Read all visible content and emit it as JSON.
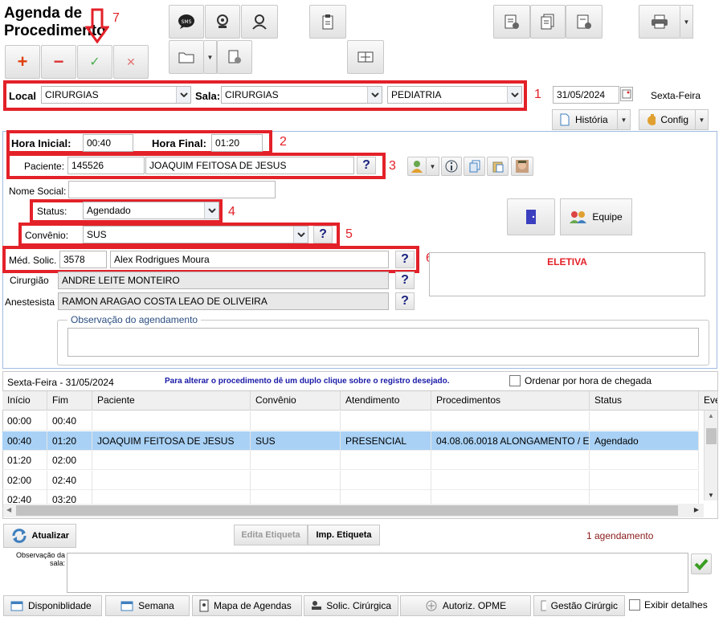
{
  "header": {
    "title_line1": "Agenda de",
    "title_line2": "Procedimento"
  },
  "toolbar": {
    "add": "+",
    "remove": "−",
    "confirm": "✓",
    "cancel": "✕"
  },
  "location": {
    "local_label": "Local",
    "local_value": "CIRURGIAS",
    "sala_label": "Sala:",
    "sala_value": "CIRURGIAS",
    "specialty_value": "PEDIATRIA",
    "date": "31/05/2024",
    "weekday": "Sexta-Feira"
  },
  "actions": {
    "historia": "História",
    "config": "Config"
  },
  "time": {
    "start_label": "Hora Inicial:",
    "start_value": "00:40",
    "end_label": "Hora Final:",
    "end_value": "01:20"
  },
  "patient": {
    "label": "Paciente:",
    "id": "145526",
    "name": "JOAQUIM  FEITOSA DE JESUS",
    "social_label": "Nome Social:",
    "social_value": ""
  },
  "status": {
    "label": "Status:",
    "value": "Agendado"
  },
  "convenio": {
    "label": "Convênio:",
    "value": "SUS"
  },
  "medico": {
    "label": "Méd. Solic.",
    "id": "3578",
    "name": "Alex Rodrigues Moura"
  },
  "cirurgiao": {
    "label": "Cirurgião",
    "value": "ANDRE LEITE MONTEIRO"
  },
  "anestesista": {
    "label": "Anestesista",
    "value": "RAMON ARAGAO COSTA LEAO DE OLIVEIRA"
  },
  "eletiva": "ELETIVA",
  "equipe": "Equipe",
  "observacao": {
    "legend": "Observação do agendamento",
    "value": ""
  },
  "annotations": {
    "n1": "1",
    "n2": "2",
    "n3": "3",
    "n4": "4",
    "n5": "5",
    "n6": "6",
    "n7": "7"
  },
  "schedule": {
    "day": "Sexta-Feira - 31/05/2024",
    "hint": "Para alterar o procedimento dê um duplo clique sobre o registro desejado.",
    "order_label": "Ordenar por hora de chegada",
    "columns": [
      "Início",
      "Fim",
      "Paciente",
      "Convênio",
      "Atendimento",
      "Procedimentos",
      "Status",
      "Eve"
    ],
    "rows": [
      [
        "00:00",
        "00:40",
        "",
        "",
        "",
        "",
        ""
      ],
      [
        "00:40",
        "01:20",
        "JOAQUIM FEITOSA DE JESUS",
        "SUS",
        "PRESENCIAL",
        "04.08.06.0018 ALONGAMENTO / E",
        "Agendado"
      ],
      [
        "01:20",
        "02:00",
        "",
        "",
        "",
        "",
        ""
      ],
      [
        "02:00",
        "02:40",
        "",
        "",
        "",
        "",
        ""
      ],
      [
        "02:40",
        "03:20",
        "",
        "",
        "",
        "",
        ""
      ]
    ]
  },
  "footer": {
    "atualizar": "Atualizar",
    "edita_etiqueta": "Edita Etiqueta",
    "imp_etiqueta": "Imp. Etiqueta",
    "count": "1 agendamento",
    "obs_sala_label1": "Observação da",
    "obs_sala_label2": "sala:",
    "obs_sala_value": "",
    "disponibilidade": "Disponiblidade",
    "semana": "Semana",
    "mapa": "Mapa de Agendas",
    "solic": "Solic. Cirúrgica",
    "autoriz": "Autoriz. OPME",
    "gestao": "Gestão Cirúrgic",
    "exibir": "Exibir detalhes"
  },
  "colors": {
    "annotation_red": "#e32129",
    "selected_row": "#a9d1f5",
    "eletiva_red": "#e32129"
  }
}
